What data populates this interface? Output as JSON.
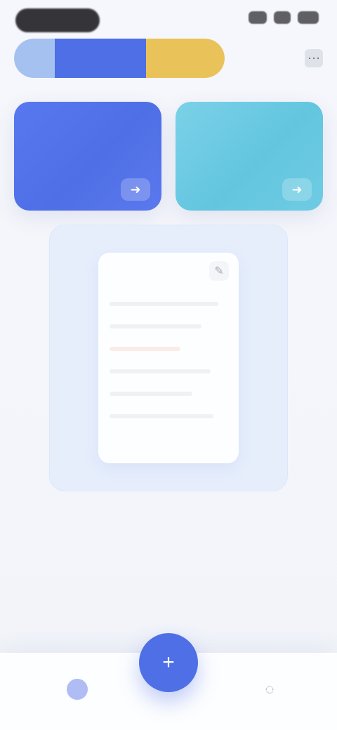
{
  "status_bar": {
    "left_pill": "",
    "right_icons": [
      "signal-icon",
      "wifi-icon",
      "battery-icon"
    ]
  },
  "top_tabs": {
    "items": [
      {
        "label": ""
      },
      {
        "label": ""
      },
      {
        "label": ""
      }
    ]
  },
  "top_right": {
    "icon": "more-icon",
    "glyph": "⋯"
  },
  "cards": [
    {
      "title": "",
      "subtitle": "",
      "icon": "arrow-icon",
      "glyph": "➜"
    },
    {
      "title": "",
      "subtitle": "",
      "icon": "arrow-icon",
      "glyph": "➜"
    }
  ],
  "panel": {
    "title": "",
    "corner_icon": "edit-icon",
    "corner_glyph": "✎"
  },
  "hint": {
    "text": ""
  },
  "bottom_nav": {
    "left": {
      "icon": "home-icon"
    },
    "center": {
      "icon": "plus-icon",
      "glyph": "+"
    },
    "right": {
      "icon": "profile-icon",
      "glyph": "◌"
    }
  },
  "colors": {
    "accent_blue": "#4f6fe6",
    "accent_teal": "#63c6df",
    "accent_yellow": "#e9c35a",
    "background": "#f3f5fb"
  }
}
